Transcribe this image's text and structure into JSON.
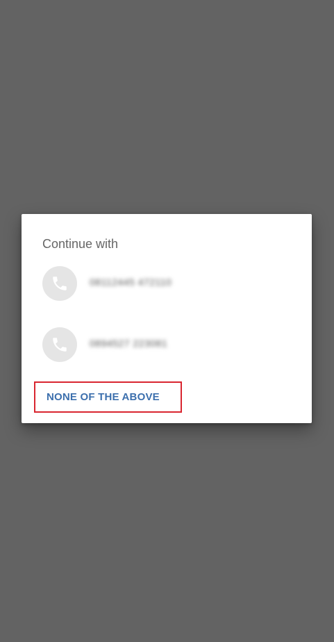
{
  "dialog": {
    "title": "Continue with",
    "accounts": [
      {
        "number": "08112445 472110",
        "icon": "phone-icon"
      },
      {
        "number": "0894527 223081",
        "icon": "phone-icon"
      }
    ],
    "none_label": "NONE OF THE ABOVE"
  },
  "colors": {
    "scrim": "#636363",
    "accent": "#3c6fad",
    "highlight": "#d9252f",
    "avatar": "#e5e5e5"
  }
}
